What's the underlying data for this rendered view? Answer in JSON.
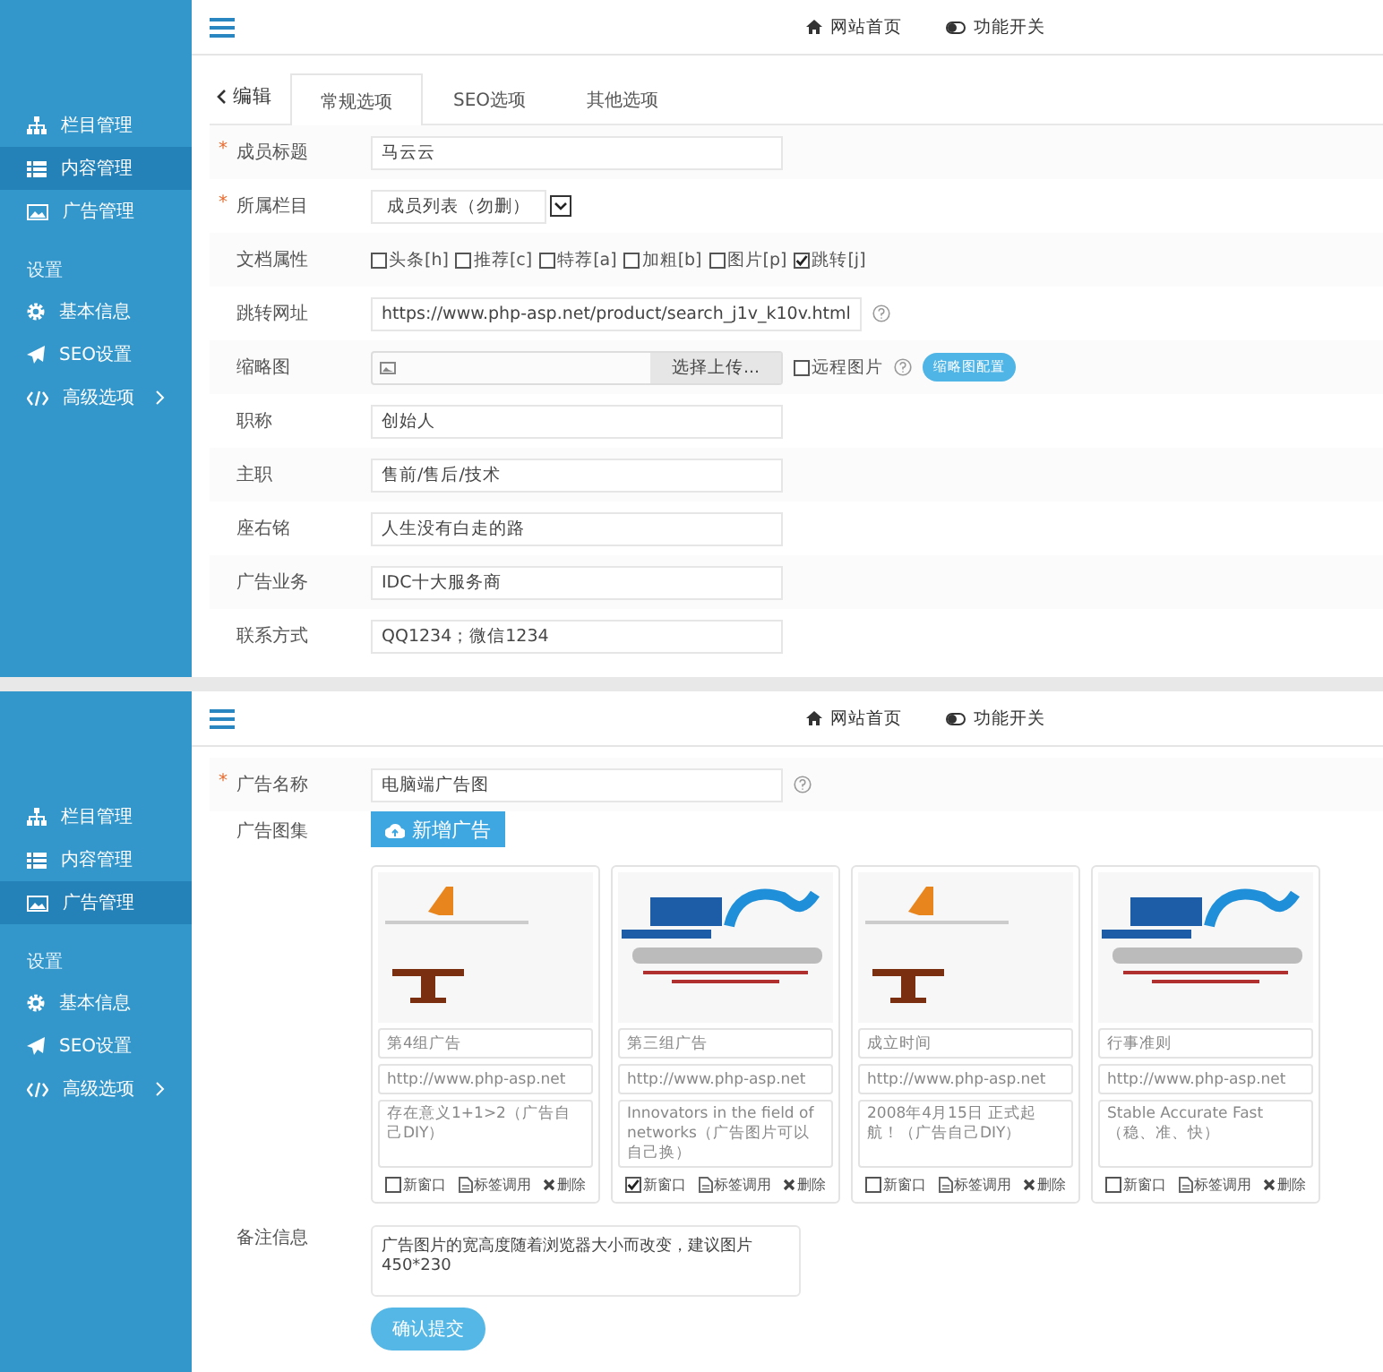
{
  "panels": [
    {
      "kind": "edit_form",
      "header": {
        "links": [
          {
            "label": "网站首页"
          },
          {
            "label": "功能开关"
          }
        ]
      },
      "sidebar": {
        "items": [
          {
            "label": "栏目管理",
            "selected": false,
            "has_submenu": false
          },
          {
            "label": "内容管理",
            "selected": true,
            "has_submenu": false
          },
          {
            "label": "广告管理",
            "selected": false,
            "has_submenu": false
          }
        ],
        "section_title": "设置",
        "settings_items": [
          {
            "label": "基本信息",
            "selected": false,
            "has_submenu": false
          },
          {
            "label": "SEO设置",
            "selected": false,
            "has_submenu": false
          },
          {
            "label": "高级选项",
            "selected": false,
            "has_submenu": true
          }
        ]
      },
      "back_label": "编辑",
      "tabs": [
        {
          "label": "常规选项",
          "selected": true
        },
        {
          "label": "SEO选项",
          "selected": false
        },
        {
          "label": "其他选项",
          "selected": false
        }
      ],
      "rows": [
        {
          "kind": "text",
          "label": "成员标题",
          "required_mark": "*",
          "help": false,
          "value": "马云云"
        },
        {
          "kind": "select",
          "label": "所属栏目",
          "required_mark": "*",
          "help": false,
          "value": "成员列表（勿删）"
        },
        {
          "kind": "checkboxes",
          "label": "文档属性",
          "help": false,
          "options": [
            {
              "label": "头条[h]",
              "checked": false
            },
            {
              "label": "推荐[c]",
              "checked": false
            },
            {
              "label": "特荐[a]",
              "checked": false
            },
            {
              "label": "加粗[b]",
              "checked": false
            },
            {
              "label": "图片[p]",
              "checked": false
            },
            {
              "label": "跳转[j]",
              "checked": true
            }
          ]
        },
        {
          "kind": "text",
          "label": "跳转网址",
          "help": true,
          "value": "https://www.php-asp.net/product/search_j1v_k10v.html"
        },
        {
          "kind": "upload",
          "label": "缩略图",
          "help": true,
          "button": "选择上传...",
          "remote": {
            "label": "远程图片",
            "checked": false
          },
          "action": "缩略图配置"
        },
        {
          "kind": "text",
          "label": "职称",
          "help": false,
          "value": "创始人"
        },
        {
          "kind": "text",
          "label": "主职",
          "help": false,
          "value": "售前/售后/技术"
        },
        {
          "kind": "text",
          "label": "座右铭",
          "help": false,
          "value": "人生没有白走的路"
        },
        {
          "kind": "text",
          "label": "广告业务",
          "help": false,
          "value": "IDC十大服务商"
        },
        {
          "kind": "text",
          "label": "联系方式",
          "help": false,
          "value": "QQ1234；微信1234"
        }
      ]
    },
    {
      "kind": "ad_form",
      "header": {
        "links": [
          {
            "label": "网站首页"
          },
          {
            "label": "功能开关"
          }
        ]
      },
      "sidebar": {
        "items": [
          {
            "label": "栏目管理",
            "selected": false,
            "has_submenu": false
          },
          {
            "label": "内容管理",
            "selected": false,
            "has_submenu": false
          },
          {
            "label": "广告管理",
            "selected": true,
            "has_submenu": false
          }
        ],
        "section_title": "设置",
        "settings_items": [
          {
            "label": "基本信息",
            "selected": false,
            "has_submenu": false
          },
          {
            "label": "SEO设置",
            "selected": false,
            "has_submenu": false
          },
          {
            "label": "高级选项",
            "selected": false,
            "has_submenu": true
          }
        ]
      },
      "name_row": {
        "label": "广告名称",
        "required_mark": "*",
        "help": true,
        "value": "电脑端广告图"
      },
      "gallery": {
        "label": "广告图集",
        "add_button": "新增广告",
        "cards": [
          {
            "kind": "advantage",
            "title": "第4组广告",
            "url": "http://www.php-asp.net",
            "description": "存在意义1+1>2（广告自己DIY）",
            "new_window": false,
            "new_window_label": "新窗口",
            "tag_label": "标签调用",
            "delete_label": "删除"
          },
          {
            "kind": "service",
            "title": "第三组广告",
            "url": "http://www.php-asp.net",
            "description": "Innovators in the field of networks（广告图片可以自己换）",
            "new_window": true,
            "new_window_label": "新窗口",
            "tag_label": "标签调用",
            "delete_label": "删除"
          },
          {
            "kind": "advantage",
            "title": "成立时间",
            "url": "http://www.php-asp.net",
            "description": "2008年4月15日 正式起航！（广告自己DIY）",
            "new_window": false,
            "new_window_label": "新窗口",
            "tag_label": "标签调用",
            "delete_label": "删除"
          },
          {
            "kind": "service",
            "title": "行事准则",
            "url": "http://www.php-asp.net",
            "description": "Stable Accurate Fast（稳、准、快）",
            "new_window": false,
            "new_window_label": "新窗口",
            "tag_label": "标签调用",
            "delete_label": "删除"
          }
        ]
      },
      "remark_row": {
        "label": "备注信息",
        "value": "广告图片的宽高度随着浏览器大小而改变，建议图片450*230"
      },
      "submit": "确认提交"
    }
  ]
}
